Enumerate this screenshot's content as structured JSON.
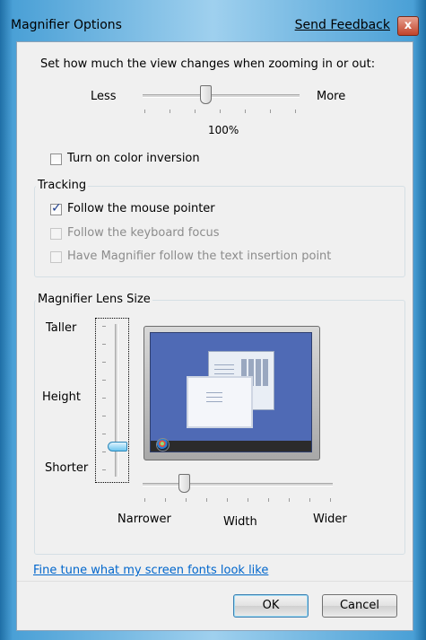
{
  "window": {
    "title": "Magnifier Options",
    "feedback_link": "Send Feedback",
    "close_glyph": "x"
  },
  "zoom": {
    "prompt": "Set how much the view changes when zooming in or out:",
    "less_label": "Less",
    "more_label": "More",
    "value_label": "100%",
    "level_fraction": 0.4
  },
  "color_inversion": {
    "label": "Turn on color inversion",
    "checked": false
  },
  "tracking": {
    "legend": "Tracking",
    "items": [
      {
        "label": "Follow the mouse pointer",
        "checked": true,
        "enabled": true
      },
      {
        "label": "Follow the keyboard focus",
        "checked": false,
        "enabled": false
      },
      {
        "label": "Have Magnifier follow the text insertion point",
        "checked": false,
        "enabled": false
      }
    ]
  },
  "lens_size": {
    "legend": "Magnifier Lens Size",
    "taller_label": "Taller",
    "height_label": "Height",
    "shorter_label": "Shorter",
    "narrower_label": "Narrower",
    "width_label": "Width",
    "wider_label": "Wider",
    "height_fraction": 0.2,
    "width_fraction": 0.22
  },
  "fonts_link": "Fine tune what my screen fonts look like",
  "buttons": {
    "ok": "OK",
    "cancel": "Cancel"
  },
  "colors": {
    "preview_screen": "#4f6ab5",
    "taskbar": "#2b2b2b",
    "link": "#0066cc"
  }
}
